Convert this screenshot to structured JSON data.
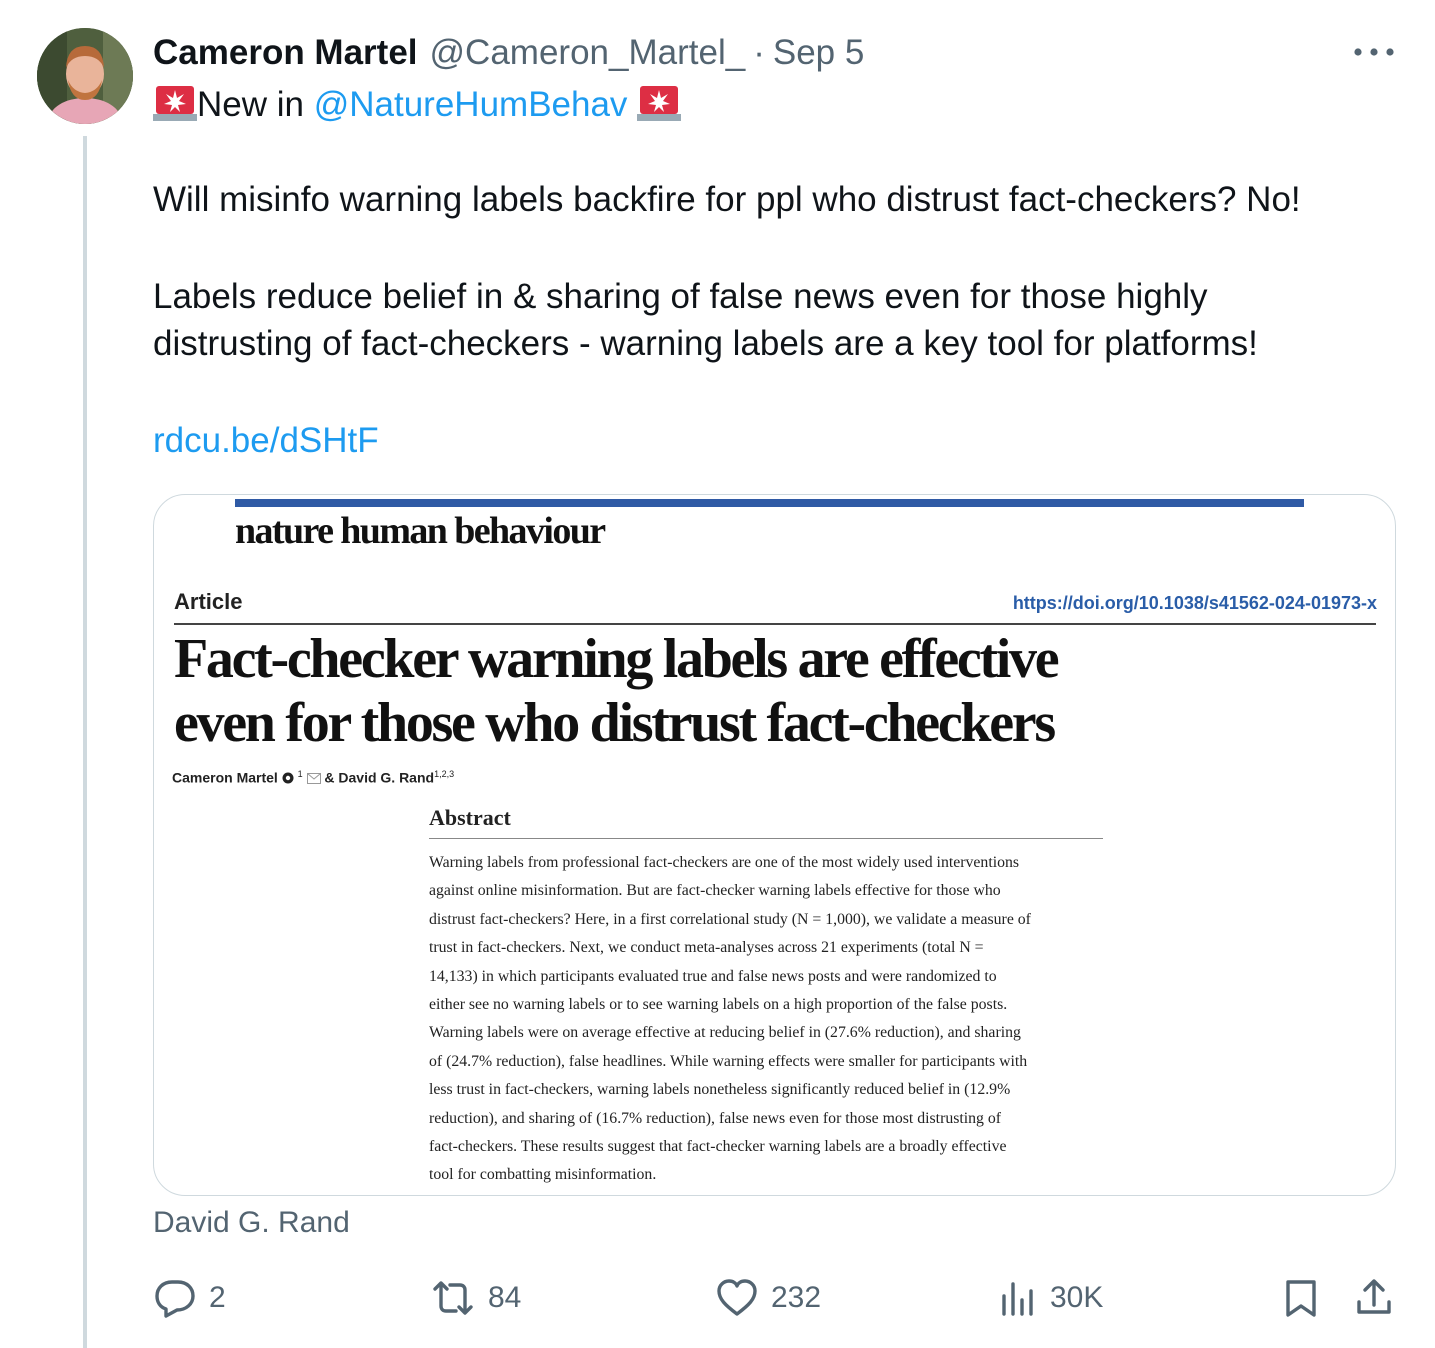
{
  "author": {
    "name": "Cameron Martel",
    "handle": "@Cameron_Martel_",
    "separator": "·",
    "date": "Sep 5"
  },
  "tweet": {
    "line1_prefix": "New in ",
    "line1_mention": "@NatureHumBehav",
    "line2": "Will misinfo warning labels backfire for ppl who distrust fact-checkers? No!",
    "line3": "Labels reduce belief in & sharing of false news even for those highly",
    "line4": "distrusting of fact-checkers - warning labels are a key tool for platforms!",
    "link": "rdcu.be/dSHtF"
  },
  "card": {
    "journal": "nature human behaviour",
    "article_label": "Article",
    "doi": "https://doi.org/10.1038/s41562-024-01973-x",
    "title_line1": "Fact-checker warning labels are effective",
    "title_line2": "even for those who distrust fact-checkers",
    "author1": "Cameron Martel",
    "author1_sup": "1",
    "authors_join": "& David G. Rand",
    "author2_sup": "1,2,3",
    "abstract_heading": "Abstract",
    "abstract_lines": [
      "Warning labels from professional fact-checkers are one of the most widely used interventions",
      "against online misinformation. But are fact-checker warning labels effective for those who",
      "distrust fact-checkers? Here, in a first correlational study (N = 1,000), we validate a measure of",
      "trust in fact-checkers. Next, we conduct meta-analyses across 21 experiments (total N =",
      "14,133) in which participants evaluated true and false news posts and were randomized to",
      "either see no warning labels or to see warning labels on a high proportion of the false posts.",
      "Warning labels were on average effective at reducing belief in (27.6% reduction), and sharing",
      "of (24.7% reduction), false headlines. While warning effects were smaller for participants with",
      "less trust in fact-checkers, warning labels nonetheless significantly reduced belief in (12.9%",
      "reduction), and sharing of (16.7% reduction), false news even for those most distrusting of",
      "fact-checkers. These results suggest that fact-checker warning labels are a broadly effective",
      "tool for combatting misinformation."
    ]
  },
  "media_caption": "David G. Rand",
  "actions": {
    "replies": "2",
    "reposts": "84",
    "likes": "232",
    "views": "30K"
  },
  "icons": [
    "more-icon",
    "siren-icon",
    "reply-icon",
    "repost-icon",
    "like-icon",
    "views-icon",
    "bookmark-icon",
    "share-icon"
  ],
  "colors": {
    "accent": "#1d9bf0",
    "muted": "#536471",
    "text": "#0f1419",
    "border": "#cfd9de",
    "journal_bar": "#2f5aa5"
  }
}
